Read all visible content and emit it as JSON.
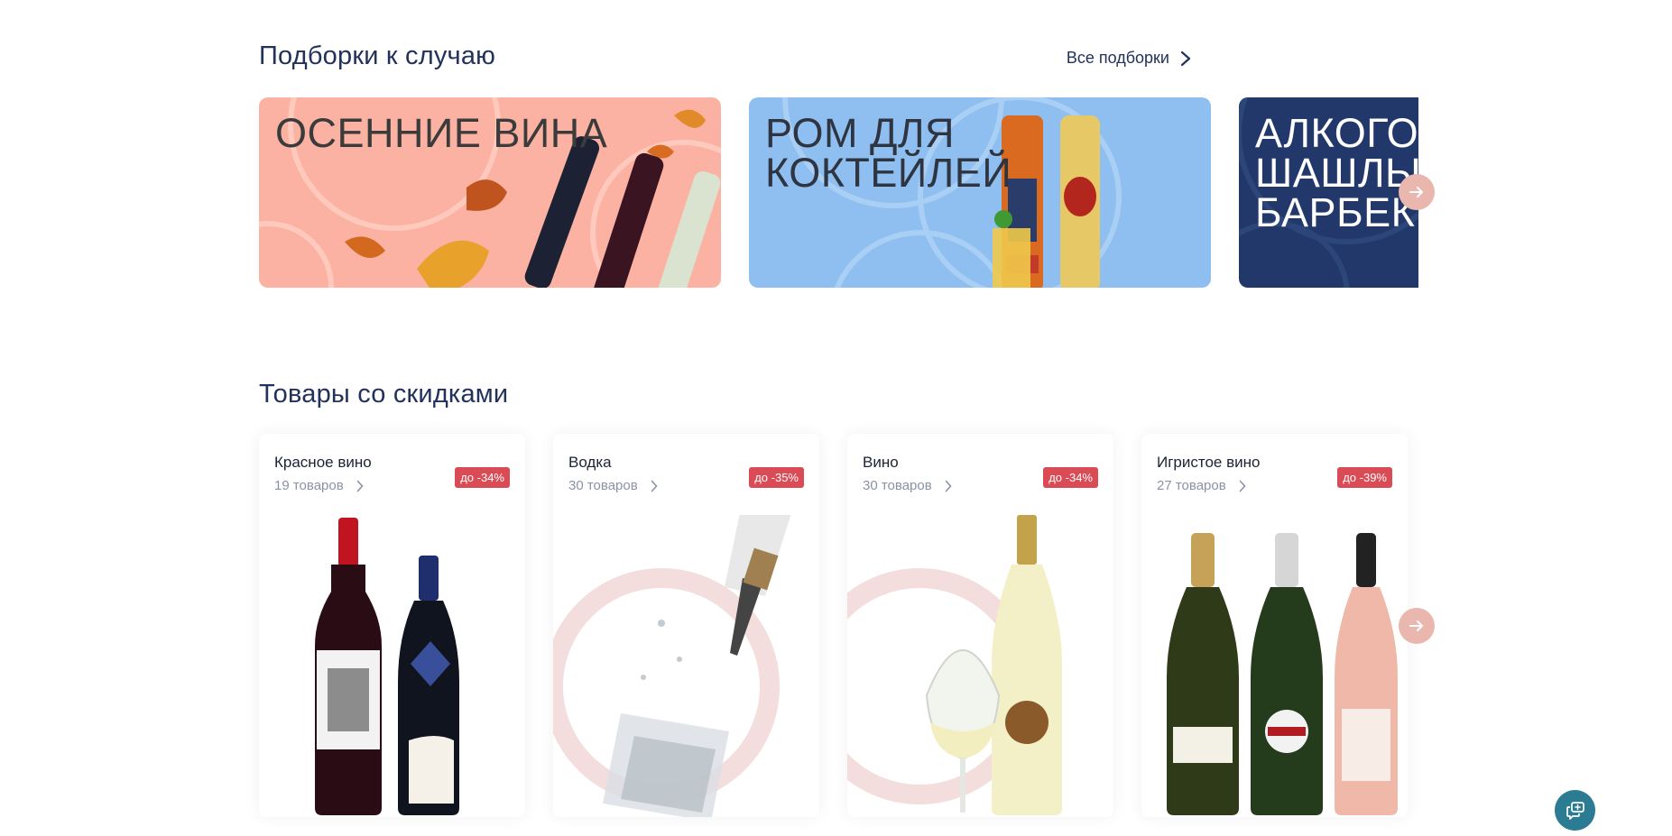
{
  "collections": {
    "title": "Подборки к случаю",
    "all_link": "Все подборки",
    "banners": [
      {
        "title": "ОСЕННИЕ ВИНА",
        "bg": "#fbb2a3",
        "text_color": "#3b3b3b"
      },
      {
        "title": "РОМ ДЛЯ КОКТЕЙЛЕЙ",
        "bg": "#8fbff0",
        "text_color": "#2e3440"
      },
      {
        "title": "АЛКОГОЛЬ\nШАШЛЫК\nБАРБЕКЮ",
        "bg": "#22386a",
        "text_color": "#ffffff"
      }
    ]
  },
  "discounts": {
    "title": "Товары со скидками",
    "cards": [
      {
        "name": "Красное вино",
        "count": "19 товаров",
        "badge": "до -34%"
      },
      {
        "name": "Водка",
        "count": "30 товаров",
        "badge": "до -35%"
      },
      {
        "name": "Вино",
        "count": "30 товаров",
        "badge": "до -34%"
      },
      {
        "name": "Игристое вино",
        "count": "27 товаров",
        "badge": "до -39%"
      }
    ]
  },
  "colors": {
    "accent": "#22325a",
    "badge": "#d94b55",
    "arrow": "#e9b7ae",
    "chat": "#2b7c93"
  },
  "icons": {
    "next": "arrow-right-icon",
    "chevron": "chevron-right-icon",
    "chat": "chat-icon"
  }
}
